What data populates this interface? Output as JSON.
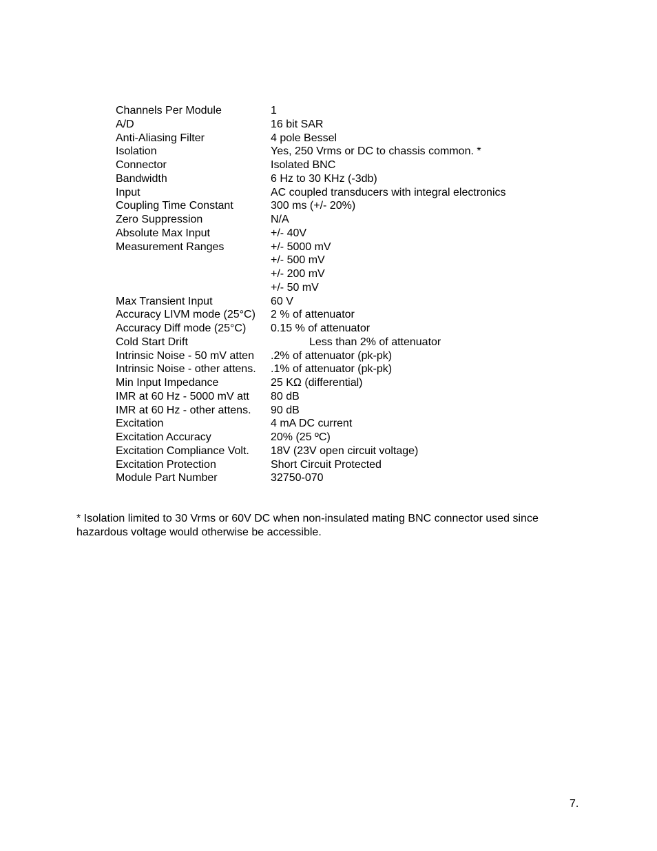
{
  "specs": [
    {
      "label": "Channels Per Module",
      "value": "1"
    },
    {
      "label": "A/D",
      "value": "16 bit SAR"
    },
    {
      "label": "Anti-Aliasing Filter",
      "value": "4 pole Bessel"
    },
    {
      "label": "Isolation",
      "value": "Yes, 250 Vrms or DC to chassis common. *"
    },
    {
      "label": "Connector",
      "value": "Isolated BNC"
    },
    {
      "label": "Bandwidth",
      "value": "6 Hz to 30 KHz (-3db)"
    },
    {
      "label": "Input",
      "value": "AC coupled transducers with integral electronics"
    },
    {
      "label": "Coupling Time Constant",
      "value": "300 ms (+/- 20%)"
    },
    {
      "label": "Zero Suppression",
      "value": "N/A"
    },
    {
      "label": "Absolute Max Input",
      "value": "+/- 40V"
    },
    {
      "label": "Measurement Ranges",
      "value": "+/- 5000 mV"
    },
    {
      "label": "",
      "value": "+/- 500 mV"
    },
    {
      "label": "",
      "value": "+/- 200 mV"
    },
    {
      "label": "",
      "value": "+/- 50 mV"
    },
    {
      "label": "Max Transient Input",
      "value": "60 V"
    },
    {
      "label": "Accuracy LIVM mode (25°C)",
      "value": "2 % of attenuator"
    },
    {
      "label": "Accuracy Diff mode (25°C)",
      "value": "0.15 % of attenuator"
    },
    {
      "label": "Cold Start Drift",
      "value": "Less than 2% of attenuator"
    },
    {
      "label": "Intrinsic Noise - 50 mV atten",
      "value": ".2% of attenuator (pk-pk)"
    },
    {
      "label": "Intrinsic Noise - other attens.",
      "value": ".1% of attenuator (pk-pk)"
    },
    {
      "label": "Min Input Impedance",
      "value": "25 KΩ (differential)"
    },
    {
      "label": "IMR at 60 Hz - 5000 mV att",
      "value": "80 dB"
    },
    {
      "label": "IMR at 60 Hz - other attens.",
      "value": "90 dB"
    },
    {
      "label": "Excitation",
      "value": "4 mA DC current"
    },
    {
      "label": "Excitation Accuracy",
      "value": "20% (25 ºC)"
    },
    {
      "label": "Excitation Compliance Volt.",
      "value": "18V (23V open circuit voltage)"
    },
    {
      "label": "Excitation Protection",
      "value": "Short Circuit Protected"
    },
    {
      "label": "Module Part Number",
      "value": "32750-070"
    }
  ],
  "footnote": "* Isolation limited to 30 Vrms or 60V DC when non-insulated mating BNC connector used since hazardous voltage would otherwise be accessible.",
  "page_number": "7."
}
